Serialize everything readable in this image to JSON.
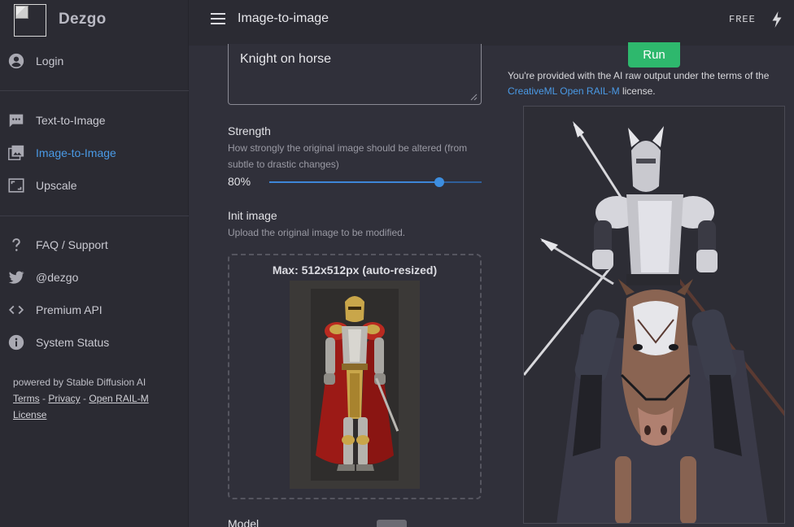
{
  "brand": {
    "name": "Dezgo"
  },
  "sidebar": {
    "login": "Login",
    "items": [
      {
        "label": "Text-to-Image",
        "icon": "chat-bubble-icon"
      },
      {
        "label": "Image-to-Image",
        "icon": "image-icon",
        "active": true
      },
      {
        "label": "Upscale",
        "icon": "upscale-icon"
      }
    ],
    "links": [
      {
        "label": "FAQ / Support",
        "icon": "question-icon"
      },
      {
        "label": "@dezgo",
        "icon": "twitter-icon"
      },
      {
        "label": "Premium API",
        "icon": "code-icon"
      },
      {
        "label": "System Status",
        "icon": "info-icon"
      }
    ],
    "footer": {
      "powered": "powered by Stable Diffusion AI",
      "terms": "Terms",
      "privacy": "Privacy",
      "license": "Open RAIL-M",
      "license2": "License",
      "sep": " - "
    }
  },
  "topbar": {
    "title": "Image-to-image",
    "plan": "FREE"
  },
  "form": {
    "prompt": "Knight on horse",
    "strength": {
      "label": "Strength",
      "help": "How strongly the original image should be altered (from subtle to drastic changes)",
      "value_text": "80%",
      "value": 0.8
    },
    "init_image": {
      "label": "Init image",
      "help": "Upload the original image to be modified.",
      "caption": "Max: 512x512px (auto-resized)"
    },
    "model": {
      "label": "Model"
    }
  },
  "run": {
    "label": "Run"
  },
  "license": {
    "text_before": "You're provided with the AI raw output under the terms of the",
    "link": "CreativeML Open RAIL-M",
    "text_after": " license."
  },
  "colors": {
    "accent": "#4a9ae6",
    "run": "#2eb86d",
    "background": "#30303a",
    "sidebar": "#2b2b33"
  }
}
